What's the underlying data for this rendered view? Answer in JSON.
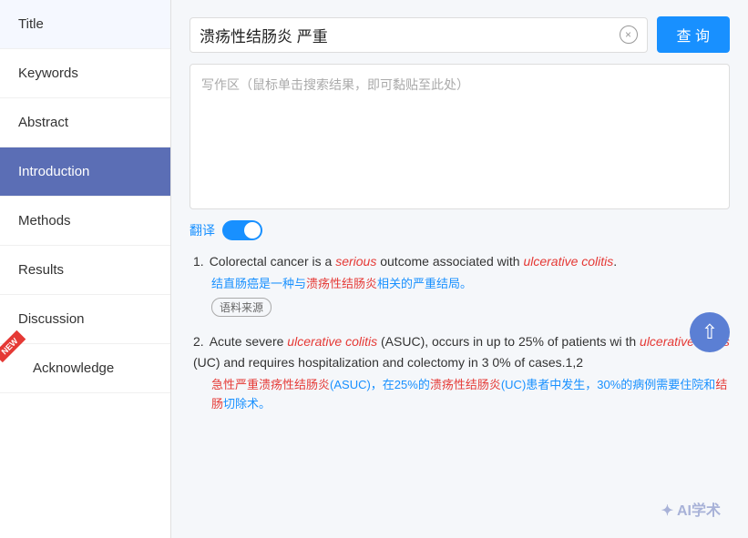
{
  "sidebar": {
    "items": [
      {
        "id": "title",
        "label": "Title",
        "active": false,
        "new": false
      },
      {
        "id": "keywords",
        "label": "Keywords",
        "active": false,
        "new": false
      },
      {
        "id": "abstract",
        "label": "Abstract",
        "active": false,
        "new": false
      },
      {
        "id": "introduction",
        "label": "Introduction",
        "active": true,
        "new": false
      },
      {
        "id": "methods",
        "label": "Methods",
        "active": false,
        "new": false
      },
      {
        "id": "results",
        "label": "Results",
        "active": false,
        "new": false
      },
      {
        "id": "discussion",
        "label": "Discussion",
        "active": false,
        "new": false
      },
      {
        "id": "acknowledge",
        "label": "Acknowledge",
        "active": false,
        "new": true
      }
    ]
  },
  "search": {
    "query": "溃疡性结肠炎 严重",
    "clear_label": "×",
    "button_label": "查 询",
    "placeholder": "写作区（鼠标单击搜索结果，即可黏贴至此处）"
  },
  "translate": {
    "label": "翻译",
    "enabled": true
  },
  "results": [
    {
      "number": "1.",
      "en_parts": [
        {
          "text": "Colorectal cancer is a ",
          "style": "normal"
        },
        {
          "text": "serious",
          "style": "italic-red"
        },
        {
          "text": " outcome associated with ",
          "style": "normal"
        },
        {
          "text": "ulcerative colitis",
          "style": "italic-red"
        },
        {
          "text": ".",
          "style": "normal"
        }
      ],
      "cn_parts": [
        {
          "text": "结直肠癌是一种与",
          "style": "normal"
        },
        {
          "text": "溃疡性结肠炎",
          "style": "red"
        },
        {
          "text": "相关的严重结局。",
          "style": "normal"
        }
      ],
      "tag": "语料来源"
    },
    {
      "number": "2.",
      "en_parts": [
        {
          "text": "Acute severe ",
          "style": "normal"
        },
        {
          "text": "ulcerative colitis",
          "style": "italic-red"
        },
        {
          "text": " (ASUC), occurs in up to 25% of patients wi th ",
          "style": "normal"
        },
        {
          "text": "ulcerative colitis",
          "style": "italic-red"
        },
        {
          "text": " (UC) and requires hospitalization and colectomy in 3 0% of cases.1,2",
          "style": "normal"
        }
      ],
      "cn_parts": [
        {
          "text": "急性严重",
          "style": "red"
        },
        {
          "text": "溃疡性结肠炎",
          "style": "red"
        },
        {
          "text": "(ASUC)，在25%的",
          "style": "normal"
        },
        {
          "text": "溃疡性结肠炎",
          "style": "red"
        },
        {
          "text": "(UC)患者中发生，30%的病例需要住院和",
          "style": "normal"
        },
        {
          "text": "结肠",
          "style": "red"
        },
        {
          "text": "切除术。",
          "style": "normal"
        }
      ],
      "tag": null
    }
  ],
  "watermark": "✦ AI学术"
}
